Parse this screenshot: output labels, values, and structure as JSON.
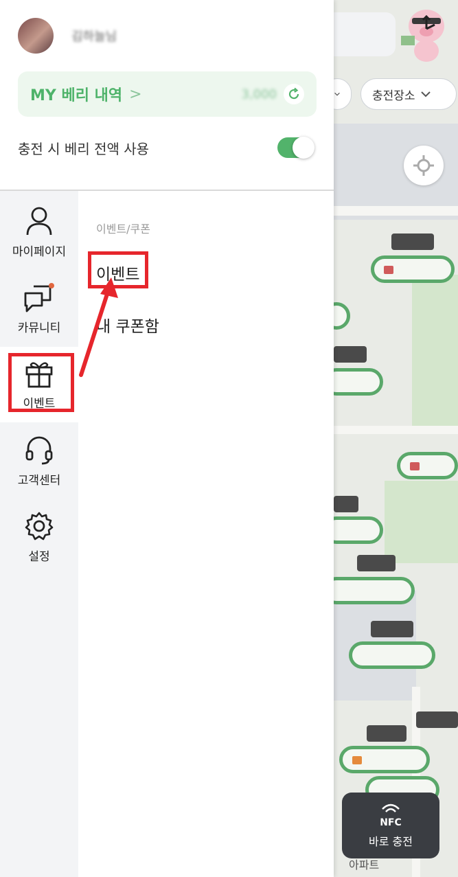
{
  "profile": {
    "username": "김하늘님"
  },
  "berry": {
    "title": "MY 베리 내역",
    "chevron": ">",
    "amount": "3,000"
  },
  "settings": {
    "use_all_berry_label": "충전 시 베리 전액 사용",
    "use_all_berry_on": true
  },
  "sidebar": {
    "items": [
      {
        "label": "마이페이지",
        "icon": "person-icon"
      },
      {
        "label": "카뮤니티",
        "icon": "chat-bubbles-icon"
      },
      {
        "label": "이벤트",
        "icon": "gift-icon"
      },
      {
        "label": "고객센터",
        "icon": "headset-icon"
      },
      {
        "label": "설정",
        "icon": "gear-icon"
      }
    ]
  },
  "submenu": {
    "header": "이벤트/쿠폰",
    "items": [
      {
        "label": "이벤트"
      },
      {
        "label": "내 쿠폰함"
      }
    ]
  },
  "map": {
    "filter_chip": "충전장소",
    "nfc_label": "NFC",
    "nfc_button": "바로 충전",
    "place_label": "아파트"
  },
  "colors": {
    "accent_green": "#4eb36a",
    "annotation_red": "#e6262c"
  }
}
